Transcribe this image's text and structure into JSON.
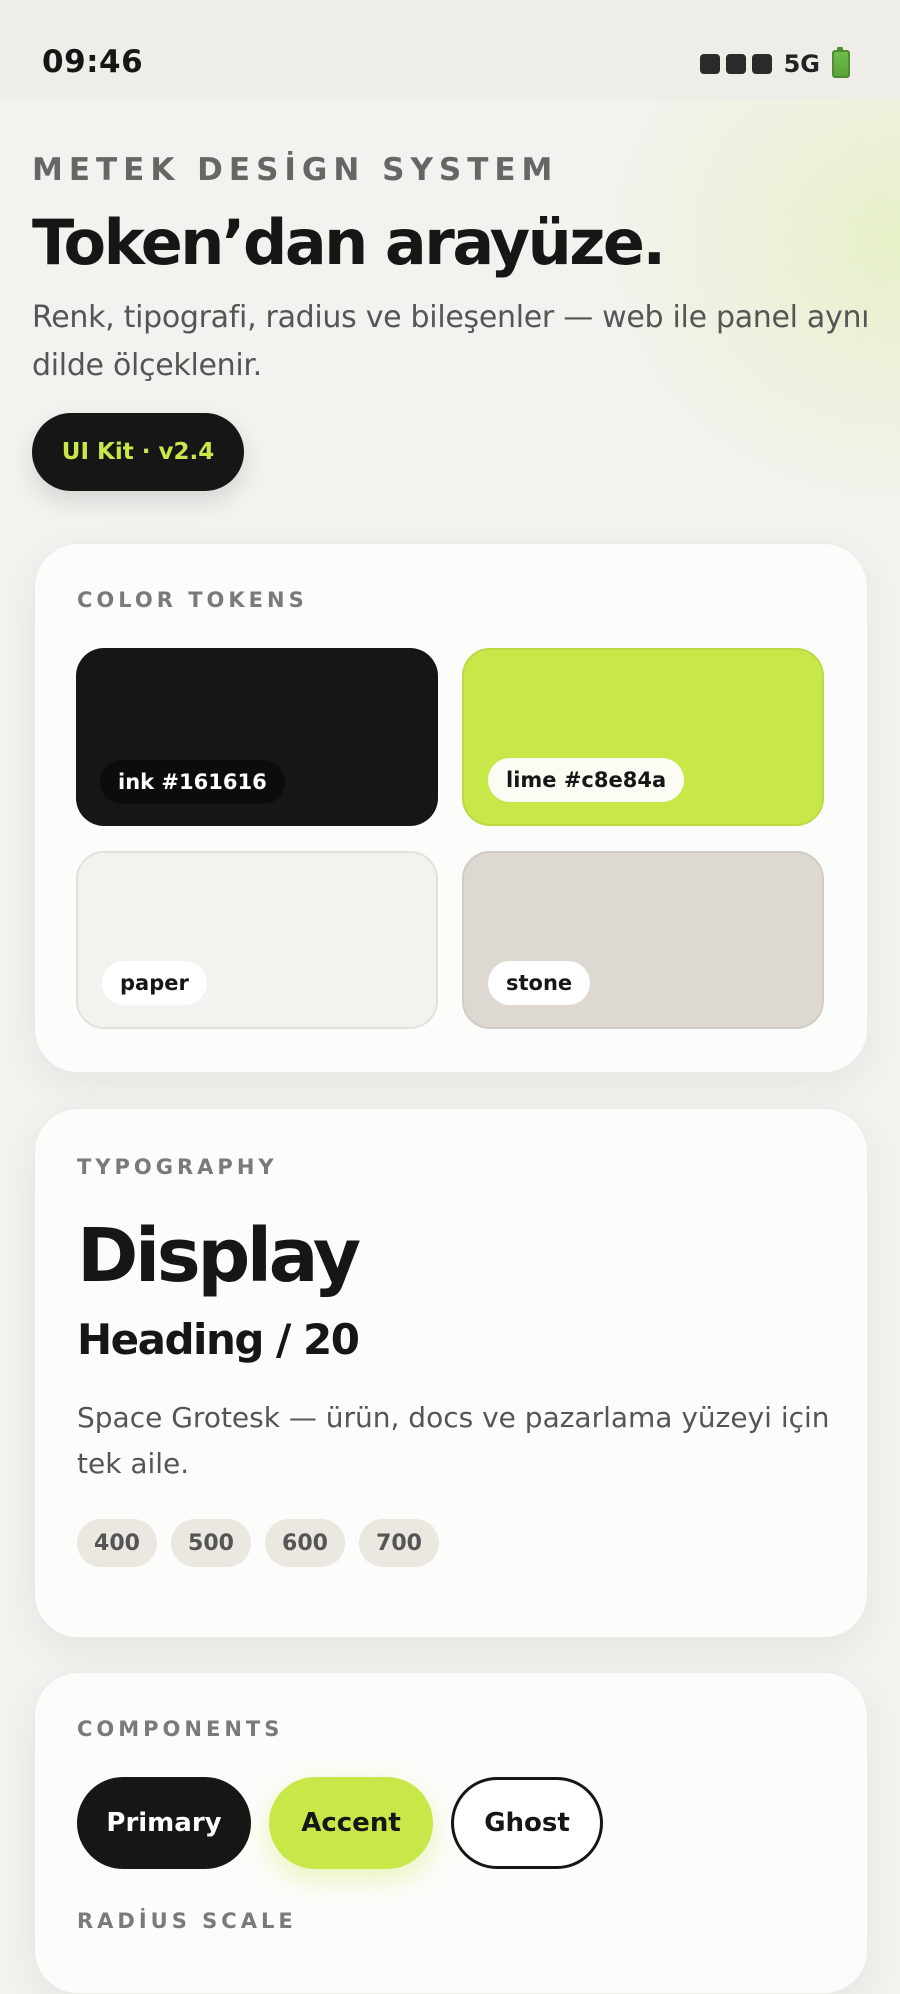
{
  "status_bar": {
    "time": "09:46",
    "network": "5G"
  },
  "hero": {
    "eyebrow": "METEK DESİGN SYSTEM",
    "title": "Token’dan arayüze.",
    "description": "Renk, tipografi, radius ve bileşenler — web ile panel aynı dilde ölçeklenir.",
    "version_pill": "UI Kit · v2.4"
  },
  "color_tokens": {
    "label": "COLOR TOKENS",
    "swatches": [
      {
        "name": "ink #161616",
        "color": "#161616"
      },
      {
        "name": "lime #c8e84a",
        "color": "#c8e84a"
      },
      {
        "name": "paper",
        "color": "#f3f2ee"
      },
      {
        "name": "stone",
        "color": "#ddd9d2"
      }
    ]
  },
  "typography": {
    "label": "TYPOGRAPHY",
    "display": "Display",
    "heading": "Heading / 20",
    "body": "Space Grotesk — ürün, docs ve pazarlama yüzeyi için tek aile.",
    "weights": [
      "400",
      "500",
      "600",
      "700"
    ]
  },
  "components": {
    "label": "COMPONENTS",
    "buttons": {
      "primary": "Primary",
      "accent": "Accent",
      "ghost": "Ghost"
    },
    "radius_label": "RADİUS SCALE"
  }
}
